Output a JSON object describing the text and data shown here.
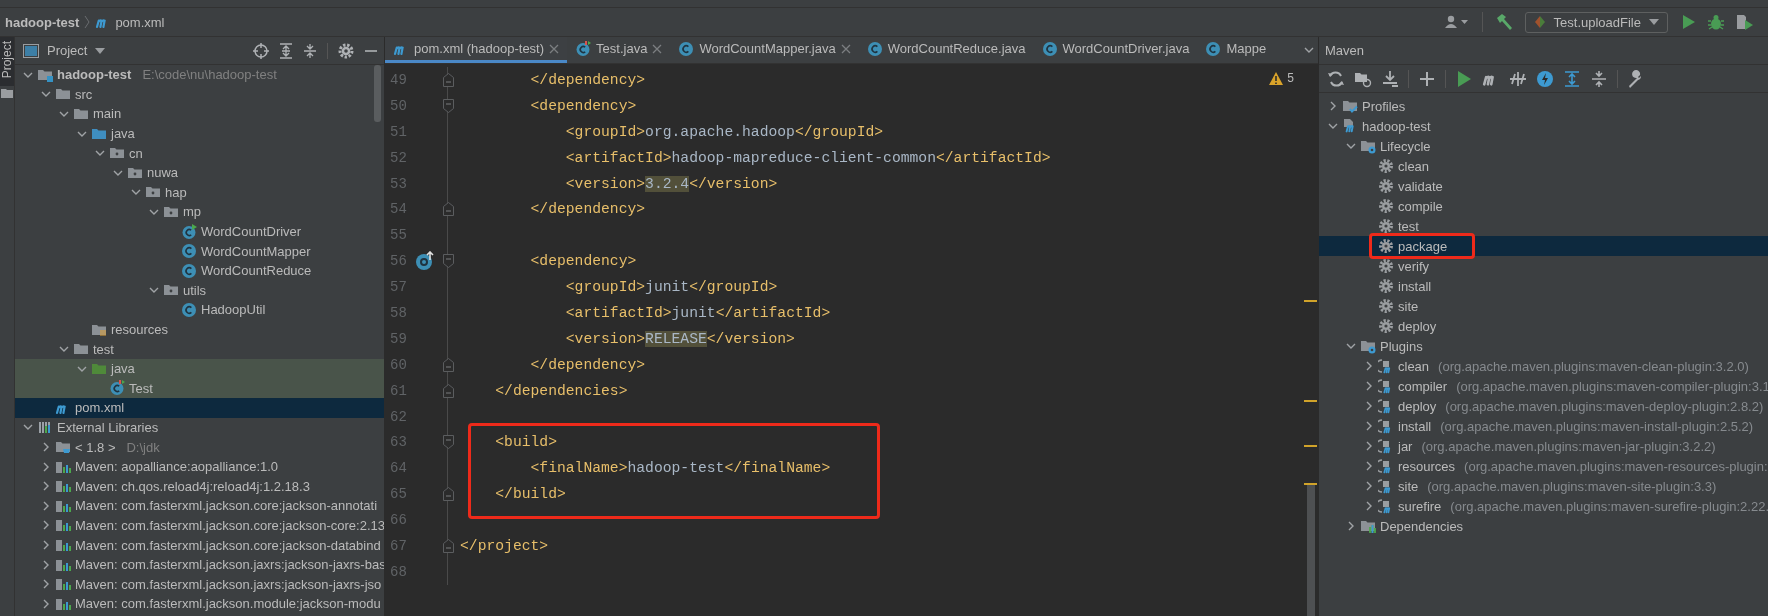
{
  "navbar": {
    "crumbs": [
      {
        "label": "hadoop-test",
        "kind": "project"
      },
      {
        "label": "pom.xml",
        "kind": "maven-file"
      }
    ],
    "run_config": {
      "label": "Test.uploadFile"
    }
  },
  "tool_strip": {
    "tabs": [
      {
        "label": "Project",
        "selected": true
      }
    ]
  },
  "project_panel": {
    "title": "Project",
    "tree": [
      {
        "label": "hadoop-test",
        "hint": "E:\\code\\nu\\hadoop-test",
        "kind": "module",
        "expanded": true,
        "selected": false,
        "highlighted": false,
        "children": [
          {
            "label": "src",
            "kind": "folder",
            "expanded": true,
            "selected": false,
            "highlighted": false,
            "children": [
              {
                "label": "main",
                "kind": "folder",
                "expanded": true,
                "selected": false,
                "highlighted": false,
                "children": [
                  {
                    "label": "java",
                    "kind": "source-root",
                    "expanded": true,
                    "selected": false,
                    "highlighted": false,
                    "children": [
                      {
                        "label": "cn",
                        "kind": "package",
                        "expanded": true,
                        "selected": false,
                        "highlighted": false,
                        "children": [
                          {
                            "label": "nuwa",
                            "kind": "package",
                            "expanded": true,
                            "selected": false,
                            "highlighted": false,
                            "children": [
                              {
                                "label": "hap",
                                "kind": "package",
                                "expanded": true,
                                "selected": false,
                                "highlighted": false,
                                "children": [
                                  {
                                    "label": "mp",
                                    "kind": "package",
                                    "expanded": true,
                                    "selected": false,
                                    "highlighted": false,
                                    "children": [
                                      {
                                        "label": "WordCountDriver",
                                        "kind": "runnable-class",
                                        "selected": false,
                                        "highlighted": false
                                      },
                                      {
                                        "label": "WordCountMapper",
                                        "kind": "class",
                                        "selected": false,
                                        "highlighted": false
                                      },
                                      {
                                        "label": "WordCountReduce",
                                        "kind": "class",
                                        "selected": false,
                                        "highlighted": false
                                      }
                                    ]
                                  },
                                  {
                                    "label": "utils",
                                    "kind": "package",
                                    "expanded": true,
                                    "selected": false,
                                    "highlighted": false,
                                    "children": [
                                      {
                                        "label": "HadoopUtil",
                                        "kind": "class",
                                        "selected": false,
                                        "highlighted": false
                                      }
                                    ]
                                  }
                                ]
                              }
                            ]
                          }
                        ]
                      }
                    ]
                  },
                  {
                    "label": "resources",
                    "kind": "resources-root",
                    "selected": false,
                    "highlighted": false
                  }
                ]
              },
              {
                "label": "test",
                "kind": "folder",
                "expanded": true,
                "selected": false,
                "highlighted": false,
                "children": [
                  {
                    "label": "java",
                    "kind": "test-root",
                    "expanded": true,
                    "selected": false,
                    "highlighted": true,
                    "children": [
                      {
                        "label": "Test",
                        "kind": "test-class",
                        "selected": false,
                        "highlighted": true
                      }
                    ]
                  }
                ]
              }
            ]
          },
          {
            "label": "pom.xml",
            "kind": "maven-file",
            "selected": true,
            "highlighted": false
          }
        ]
      },
      {
        "label": "External Libraries",
        "kind": "libraries",
        "expanded": true,
        "selected": false,
        "highlighted": false,
        "children": [
          {
            "label": "< 1.8 >",
            "hint": "D:\\jdk",
            "kind": "jdk",
            "expanded": false,
            "selected": false,
            "highlighted": false
          },
          {
            "label": "Maven: aopalliance:aopalliance:1.0",
            "kind": "library",
            "expanded": false,
            "selected": false,
            "highlighted": false
          },
          {
            "label": "Maven: ch.qos.reload4j:reload4j:1.2.18.3",
            "kind": "library",
            "expanded": false,
            "selected": false,
            "highlighted": false
          },
          {
            "label": "Maven: com.fasterxml.jackson.core:jackson-annotati",
            "kind": "library",
            "expanded": false,
            "selected": false,
            "highlighted": false
          },
          {
            "label": "Maven: com.fasterxml.jackson.core:jackson-core:2.13",
            "kind": "library",
            "expanded": false,
            "selected": false,
            "highlighted": false
          },
          {
            "label": "Maven: com.fasterxml.jackson.core:jackson-databind",
            "kind": "library",
            "expanded": false,
            "selected": false,
            "highlighted": false
          },
          {
            "label": "Maven: com.fasterxml.jackson.jaxrs:jackson-jaxrs-bas",
            "kind": "library",
            "expanded": false,
            "selected": false,
            "highlighted": false
          },
          {
            "label": "Maven: com.fasterxml.jackson.jaxrs:jackson-jaxrs-jso",
            "kind": "library",
            "expanded": false,
            "selected": false,
            "highlighted": false
          },
          {
            "label": "Maven: com.fasterxml.jackson.module:jackson-modu",
            "kind": "library",
            "expanded": false,
            "selected": false,
            "highlighted": false
          }
        ]
      }
    ]
  },
  "editor": {
    "tabs": [
      {
        "label": "pom.xml (hadoop-test)",
        "kind": "maven-file",
        "selected": true,
        "closable": true
      },
      {
        "label": "Test.java",
        "kind": "test-class",
        "selected": false,
        "closable": true
      },
      {
        "label": "WordCountMapper.java",
        "kind": "class",
        "selected": false,
        "closable": true
      },
      {
        "label": "WordCountReduce.java",
        "kind": "class",
        "selected": false,
        "closable": false
      },
      {
        "label": "WordCountDriver.java",
        "kind": "class",
        "selected": false,
        "closable": false
      },
      {
        "label": "Mappe",
        "kind": "class",
        "selected": false,
        "closable": false
      }
    ],
    "inspection": {
      "count": "5"
    },
    "lines": [
      {
        "number": "49",
        "fold_start": false,
        "fold_end": true,
        "outlined": false,
        "tokens": [
          {
            "kind": "tag",
            "text": "        </dependency>"
          }
        ]
      },
      {
        "number": "50",
        "fold_start": true,
        "fold_end": false,
        "outlined": false,
        "tokens": [
          {
            "kind": "tag",
            "text": "        <dependency>"
          }
        ]
      },
      {
        "number": "51",
        "fold_start": false,
        "fold_end": false,
        "outlined": false,
        "tokens": [
          {
            "kind": "tag",
            "text": "            <groupId>"
          },
          {
            "kind": "text",
            "text": "org.apache.hadoop"
          },
          {
            "kind": "tag",
            "text": "</groupId>"
          }
        ]
      },
      {
        "number": "52",
        "fold_start": false,
        "fold_end": false,
        "outlined": false,
        "tokens": [
          {
            "kind": "tag",
            "text": "            <artifactId>"
          },
          {
            "kind": "text",
            "text": "hadoop-mapreduce-client-common"
          },
          {
            "kind": "tag",
            "text": "</artifactId>"
          }
        ]
      },
      {
        "number": "53",
        "fold_start": false,
        "fold_end": false,
        "outlined": false,
        "tokens": [
          {
            "kind": "tag",
            "text": "            <version>"
          },
          {
            "kind": "match",
            "text": "3.2.4"
          },
          {
            "kind": "tag",
            "text": "</version>"
          }
        ]
      },
      {
        "number": "54",
        "fold_start": false,
        "fold_end": true,
        "outlined": false,
        "tokens": [
          {
            "kind": "tag",
            "text": "        </dependency>"
          }
        ]
      },
      {
        "number": "55",
        "fold_start": false,
        "fold_end": false,
        "outlined": false
      },
      {
        "number": "56",
        "fold_start": true,
        "fold_end": false,
        "marker": true,
        "outlined": false,
        "tokens": [
          {
            "kind": "tag",
            "text": "        <dependency>"
          }
        ]
      },
      {
        "number": "57",
        "fold_start": false,
        "fold_end": false,
        "outlined": false,
        "tokens": [
          {
            "kind": "tag",
            "text": "            <groupId>"
          },
          {
            "kind": "text",
            "text": "junit"
          },
          {
            "kind": "tag",
            "text": "</groupId>"
          }
        ]
      },
      {
        "number": "58",
        "fold_start": false,
        "fold_end": false,
        "outlined": false,
        "tokens": [
          {
            "kind": "tag",
            "text": "            <artifactId>"
          },
          {
            "kind": "text",
            "text": "junit"
          },
          {
            "kind": "tag",
            "text": "</artifactId>"
          }
        ]
      },
      {
        "number": "59",
        "fold_start": false,
        "fold_end": false,
        "outlined": false,
        "tokens": [
          {
            "kind": "tag",
            "text": "            <version>"
          },
          {
            "kind": "match",
            "text": "RELEASE"
          },
          {
            "kind": "tag",
            "text": "</version>"
          }
        ]
      },
      {
        "number": "60",
        "fold_start": false,
        "fold_end": true,
        "outlined": false,
        "tokens": [
          {
            "kind": "tag",
            "text": "        </dependency>"
          }
        ]
      },
      {
        "number": "61",
        "fold_start": false,
        "fold_end": true,
        "outlined": false,
        "tokens": [
          {
            "kind": "tag",
            "text": "    </dependencies>"
          }
        ]
      },
      {
        "number": "62",
        "fold_start": false,
        "fold_end": false,
        "outlined": false
      },
      {
        "number": "63",
        "fold_start": true,
        "fold_end": false,
        "outlined": true,
        "tokens": [
          {
            "kind": "tag",
            "text": "    <build>"
          }
        ]
      },
      {
        "number": "64",
        "fold_start": false,
        "fold_end": false,
        "outlined": true,
        "tokens": [
          {
            "kind": "tag",
            "text": "        <finalName>"
          },
          {
            "kind": "text",
            "text": "hadoop-test"
          },
          {
            "kind": "tag",
            "text": "</finalName>"
          }
        ]
      },
      {
        "number": "65",
        "fold_start": false,
        "fold_end": true,
        "outlined": true,
        "tokens": [
          {
            "kind": "tag",
            "text": "    </build>"
          }
        ]
      },
      {
        "number": "66",
        "fold_start": false,
        "fold_end": false,
        "outlined": false
      },
      {
        "number": "67",
        "fold_start": false,
        "fold_end": true,
        "outlined": false,
        "tokens": [
          {
            "kind": "tag",
            "text": "</project>"
          }
        ]
      },
      {
        "number": "68",
        "fold_start": false,
        "fold_end": false,
        "outlined": false
      }
    ]
  },
  "maven_panel": {
    "title": "Maven",
    "tree": [
      {
        "label": "Profiles",
        "kind": "profiles",
        "expanded": false,
        "selected": false,
        "outlined": false
      },
      {
        "label": "hadoop-test",
        "kind": "project",
        "expanded": true,
        "selected": false,
        "outlined": false,
        "children": [
          {
            "label": "Lifecycle",
            "kind": "lifecycle",
            "expanded": true,
            "selected": false,
            "outlined": false,
            "children": [
              {
                "label": "clean",
                "kind": "goal",
                "selected": false,
                "outlined": false
              },
              {
                "label": "validate",
                "kind": "goal",
                "selected": false,
                "outlined": false
              },
              {
                "label": "compile",
                "kind": "goal",
                "selected": false,
                "outlined": false
              },
              {
                "label": "test",
                "kind": "goal",
                "selected": false,
                "outlined": false
              },
              {
                "label": "package",
                "kind": "goal",
                "selected": true,
                "outlined": true
              },
              {
                "label": "verify",
                "kind": "goal",
                "selected": false,
                "outlined": false
              },
              {
                "label": "install",
                "kind": "goal",
                "selected": false,
                "outlined": false
              },
              {
                "label": "site",
                "kind": "goal",
                "selected": false,
                "outlined": false
              },
              {
                "label": "deploy",
                "kind": "goal",
                "selected": false,
                "outlined": false
              }
            ]
          },
          {
            "label": "Plugins",
            "kind": "plugins",
            "expanded": true,
            "selected": false,
            "outlined": false,
            "children": [
              {
                "label": "clean",
                "detail": "(org.apache.maven.plugins:maven-clean-plugin:3.2.0)",
                "kind": "plugin",
                "expanded": false,
                "selected": false,
                "outlined": false
              },
              {
                "label": "compiler",
                "detail": "(org.apache.maven.plugins:maven-compiler-plugin:3.1",
                "kind": "plugin",
                "expanded": false,
                "selected": false,
                "outlined": false
              },
              {
                "label": "deploy",
                "detail": "(org.apache.maven.plugins:maven-deploy-plugin:2.8.2)",
                "kind": "plugin",
                "expanded": false,
                "selected": false,
                "outlined": false
              },
              {
                "label": "install",
                "detail": "(org.apache.maven.plugins:maven-install-plugin:2.5.2)",
                "kind": "plugin",
                "expanded": false,
                "selected": false,
                "outlined": false
              },
              {
                "label": "jar",
                "detail": "(org.apache.maven.plugins:maven-jar-plugin:3.2.2)",
                "kind": "plugin",
                "expanded": false,
                "selected": false,
                "outlined": false
              },
              {
                "label": "resources",
                "detail": "(org.apache.maven.plugins:maven-resources-plugin:",
                "kind": "plugin",
                "expanded": false,
                "selected": false,
                "outlined": false
              },
              {
                "label": "site",
                "detail": "(org.apache.maven.plugins:maven-site-plugin:3.3)",
                "kind": "plugin",
                "expanded": false,
                "selected": false,
                "outlined": false
              },
              {
                "label": "surefire",
                "detail": "(org.apache.maven.plugins:maven-surefire-plugin:2.22.",
                "kind": "plugin",
                "expanded": false,
                "selected": false,
                "outlined": false
              }
            ]
          },
          {
            "label": "Dependencies",
            "kind": "dependencies",
            "expanded": false,
            "selected": false,
            "outlined": false
          }
        ]
      }
    ]
  }
}
